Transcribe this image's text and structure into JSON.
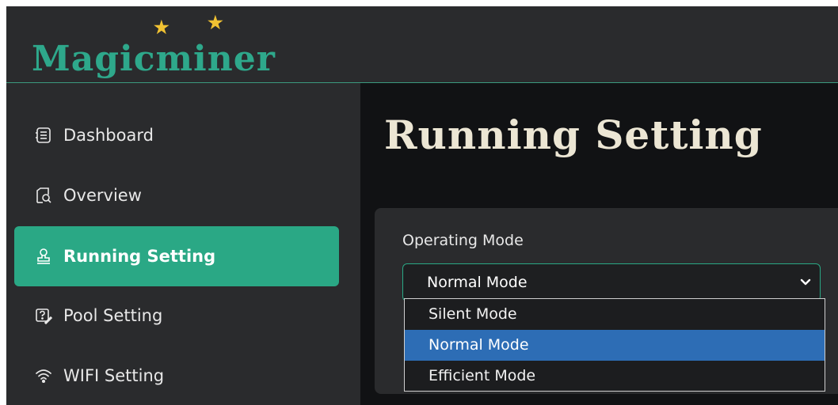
{
  "app": {
    "logo_text": "Magicminer",
    "accent_color": "#2aa885",
    "star_color": "#f1c232"
  },
  "sidebar": {
    "items": [
      {
        "label": "Dashboard",
        "icon": "dashboard-icon"
      },
      {
        "label": "Overview",
        "icon": "overview-icon"
      },
      {
        "label": "Running Setting",
        "icon": "stamp-icon",
        "active": true
      },
      {
        "label": "Pool Setting",
        "icon": "pool-edit-icon"
      },
      {
        "label": "WIFI Setting",
        "icon": "wifi-icon"
      }
    ]
  },
  "main": {
    "title": "Running Setting",
    "operating_mode": {
      "label": "Operating Mode",
      "selected": "Normal Mode",
      "options": [
        "Silent Mode",
        "Normal Mode",
        "Efficient Mode"
      ]
    }
  }
}
